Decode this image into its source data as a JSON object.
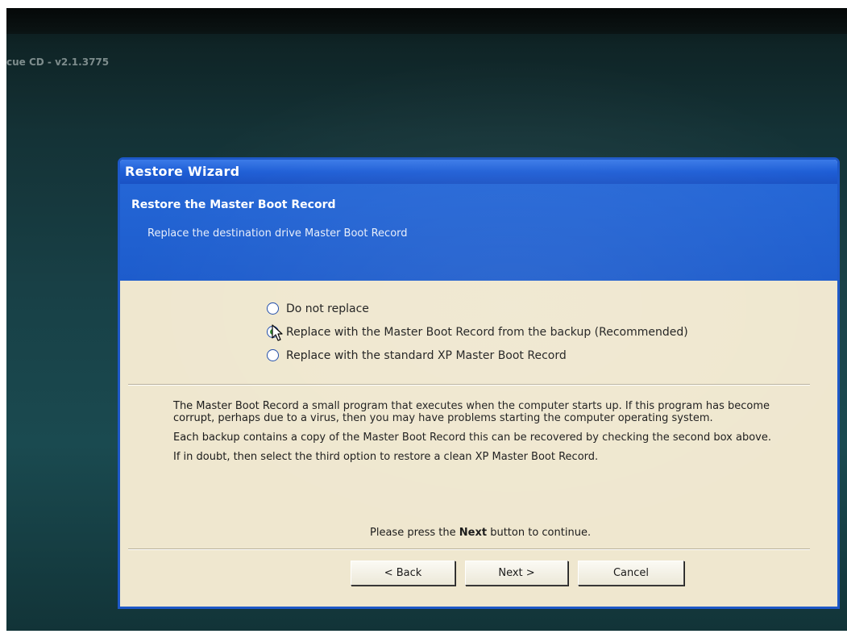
{
  "app": {
    "title": "cue CD - v2.1.3775"
  },
  "dialog": {
    "title": "Restore Wizard",
    "header_title": "Restore the Master Boot Record",
    "header_subtitle": "Replace the destination drive Master Boot Record"
  },
  "options": [
    {
      "label": "Do not replace",
      "checked": false
    },
    {
      "label": "Replace with the Master Boot Record from the backup (Recommended)",
      "checked": true
    },
    {
      "label": "Replace with the standard XP Master Boot Record",
      "checked": false
    }
  ],
  "description": [
    "The Master Boot Record a small program that executes when the computer starts up. If this program has become corrupt, perhaps due to a virus, then you may have problems starting the computer operating system.",
    "Each backup contains a copy of the Master Boot Record this can be recovered by checking the second box above.",
    "If in doubt, then select the third option to restore a clean XP Master Boot Record."
  ],
  "continue_text": {
    "before": "Please press the",
    "bold": "Next",
    "after": "button to continue."
  },
  "buttons": {
    "back": "< Back",
    "next": "Next >",
    "cancel": "Cancel"
  },
  "colors": {
    "accent": "#1d5ccc",
    "dialog_background": "#efe7cf",
    "desktop": "#184046"
  },
  "icons": {
    "cursor": "arrow-pointer-icon",
    "radio_checked": "radio-checked-icon",
    "radio_unchecked": "radio-unchecked-icon"
  }
}
